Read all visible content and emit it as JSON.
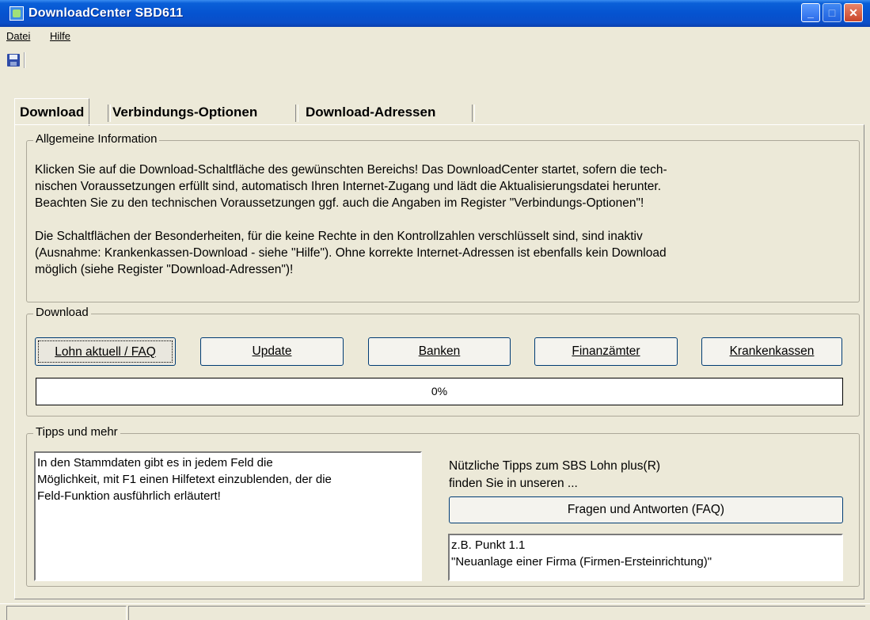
{
  "window": {
    "title": "DownloadCenter SBD611",
    "min": "_",
    "max": "□",
    "close": "✕"
  },
  "menu": {
    "datei": "Datei",
    "hilfe": "Hilfe"
  },
  "tabs": [
    {
      "label": "Download"
    },
    {
      "label": "Verbindungs-Optionen"
    },
    {
      "label": "Download-Adressen"
    }
  ],
  "info": {
    "title": "Allgemeine Information",
    "lines": [
      "Klicken Sie auf die Download-Schaltfläche des gewünschten Bereichs! Das DownloadCenter startet, sofern die tech-",
      "nischen Voraussetzungen erfüllt sind, automatisch Ihren Internet-Zugang und lädt die Aktualisierungsdatei herunter.",
      "Beachten Sie zu den technischen Voraussetzungen ggf. auch die Angaben im Register \"Verbindungs-Optionen\"!",
      "Die Schaltflächen der Besonderheiten, für die keine Rechte in den Kontrollzahlen verschlüsselt sind, sind inaktiv",
      "(Ausnahme: Krankenkassen-Download - siehe \"Hilfe\"). Ohne korrekte Internet-Adressen ist ebenfalls kein Download",
      "möglich (siehe Register \"Download-Adressen\")!"
    ]
  },
  "download": {
    "title": "Download",
    "buttons": [
      {
        "label": "Lohn aktuell / FAQ"
      },
      {
        "label": "Update"
      },
      {
        "label": "Banken"
      },
      {
        "label": "Finanzämter"
      },
      {
        "label": "Krankenkassen"
      }
    ],
    "progress": 0,
    "progress_label": "0%"
  },
  "tipps": {
    "title": "Tipps und mehr",
    "tip_lines": [
      "In den Stammdaten gibt es in jedem Feld die",
      "Möglichkeit, mit F1 einen Hilfetext einzublenden, der die",
      "Feld-Funktion ausführlich erläutert!"
    ],
    "side_text": [
      "Nützliche Tipps zum SBS Lohn plus(R)",
      "finden Sie in unseren ..."
    ],
    "faq_button": "Fragen und Antworten (FAQ)",
    "example_lines": [
      "z.B. Punkt 1.1",
      "\"Neuanlage einer Firma (Firmen-Ersteinrichtung)\""
    ]
  }
}
